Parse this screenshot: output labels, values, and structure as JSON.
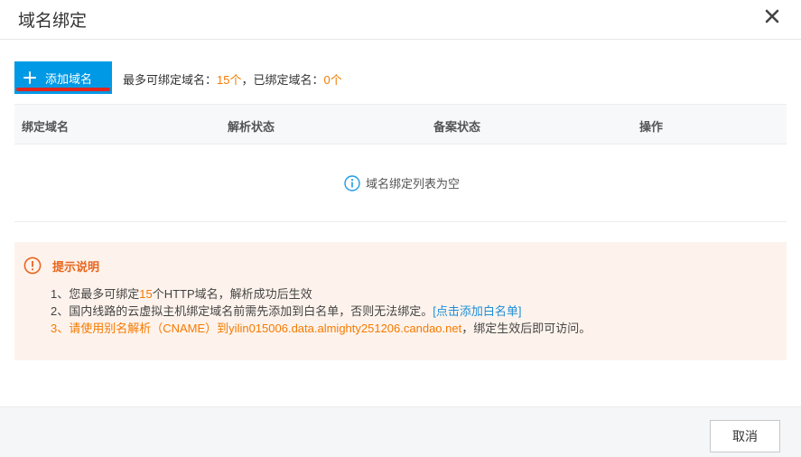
{
  "dialog": {
    "title": "域名绑定"
  },
  "toolbar": {
    "add_label": "添加域名",
    "quota_prefix": "最多可绑定域名：",
    "quota_max": "15个",
    "quota_mid": "，已绑定域名：",
    "quota_bound": "0个"
  },
  "table": {
    "columns": [
      "绑定域名",
      "解析状态",
      "备案状态",
      "操作"
    ],
    "empty_text": "域名绑定列表为空"
  },
  "notice": {
    "title": "提示说明",
    "line1_a": "1、您最多可绑定",
    "line1_num": "15",
    "line1_b": "个HTTP域名，解析成功后生效",
    "line2_text": "2、国内线路的云虚拟主机绑定域名前需先添加到白名单，否则无法绑定。",
    "line2_link": "[点击添加白名单]",
    "line3_num": "3、",
    "line3_highlight": "请使用别名解析（CNAME）到yilin015006.data.almighty251206.candao.net",
    "line3_rest": "，绑定生效后即可访问。"
  },
  "footer": {
    "cancel_label": "取消"
  },
  "colors": {
    "primary": "#0099e5",
    "accent_orange": "#f57a00",
    "notice_bg": "#fef3ec",
    "link": "#1d8ed8",
    "underline_red": "#e0271f"
  },
  "icons": {
    "close": "close-icon",
    "plus": "plus-icon",
    "info": "info-icon",
    "warning": "warning-icon"
  }
}
